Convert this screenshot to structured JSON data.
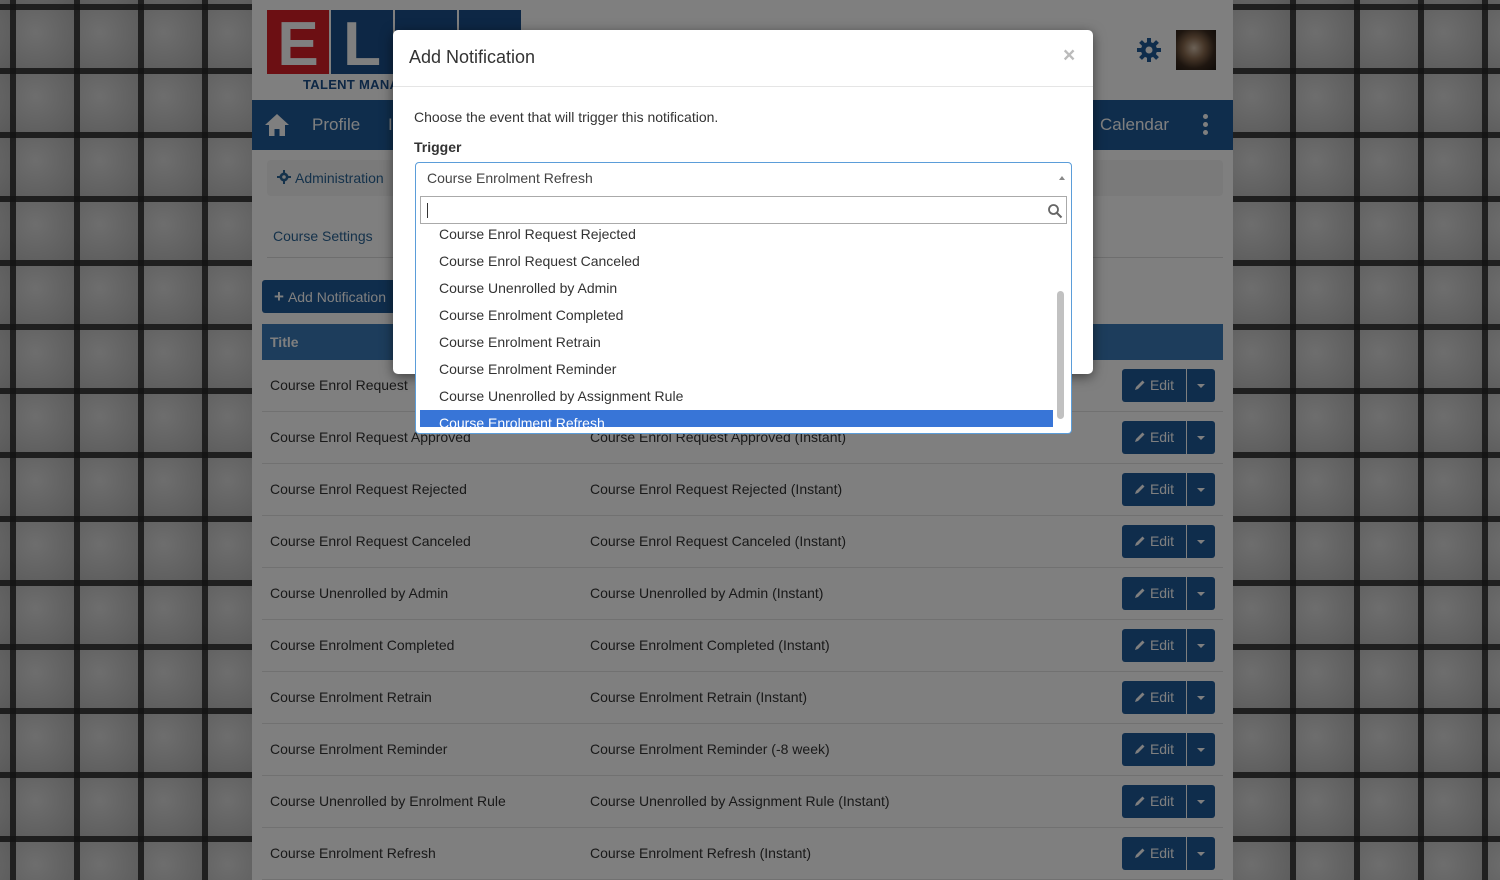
{
  "brand": {
    "logo_letters": "ELMO",
    "logo_subtitle": "TALENT MANA",
    "colors": {
      "red": "#d81f26",
      "blue": "#1a4f8b"
    }
  },
  "header": {
    "settings_icon": "gear-icon",
    "avatar_icon": "user-avatar"
  },
  "nav": {
    "home_icon": "home-icon",
    "items": [
      {
        "label": "Profile"
      },
      {
        "label": "I"
      },
      {
        "label": "Calendar"
      }
    ],
    "more_icon": "kebab-menu-icon",
    "color": "#1f5b99"
  },
  "breadcrumb": {
    "admin_label": "Administration"
  },
  "subnav": {
    "course_settings": "Course Settings"
  },
  "toolbar": {
    "add_notification_label": "Add Notification"
  },
  "table": {
    "header_title": "Title",
    "edit_label": "Edit",
    "rows": [
      {
        "title": "Course Enrol Request",
        "desc": ""
      },
      {
        "title": "Course Enrol Request Approved",
        "desc": "Course Enrol Request Approved (Instant)"
      },
      {
        "title": "Course Enrol Request Rejected",
        "desc": "Course Enrol Request Rejected (Instant)"
      },
      {
        "title": "Course Enrol Request Canceled",
        "desc": "Course Enrol Request Canceled (Instant)"
      },
      {
        "title": "Course Unenrolled by Admin",
        "desc": "Course Unenrolled by Admin (Instant)"
      },
      {
        "title": "Course Enrolment Completed",
        "desc": "Course Enrolment Completed (Instant)"
      },
      {
        "title": "Course Enrolment Retrain",
        "desc": "Course Enrolment Retrain (Instant)"
      },
      {
        "title": "Course Enrolment Reminder",
        "desc": "Course Enrolment Reminder (-8 week)"
      },
      {
        "title": "Course Unenrolled by Enrolment Rule",
        "desc": "Course Unenrolled by Assignment Rule (Instant)"
      },
      {
        "title": "Course Enrolment Refresh",
        "desc": "Course Enrolment Refresh (Instant)"
      }
    ]
  },
  "modal": {
    "title": "Add Notification",
    "close": "×",
    "intro": "Choose the event that will trigger this notification.",
    "trigger_label": "Trigger",
    "selected_value": "Course Enrolment Refresh",
    "search_value": "",
    "options": [
      {
        "label": "Course Enrol Request Rejected",
        "highlighted": false
      },
      {
        "label": "Course Enrol Request Canceled",
        "highlighted": false
      },
      {
        "label": "Course Unenrolled by Admin",
        "highlighted": false
      },
      {
        "label": "Course Enrolment Completed",
        "highlighted": false
      },
      {
        "label": "Course Enrolment Retrain",
        "highlighted": false
      },
      {
        "label": "Course Enrolment Reminder",
        "highlighted": false
      },
      {
        "label": "Course Unenrolled by Assignment Rule",
        "highlighted": false
      },
      {
        "label": "Course Enrolment Refresh",
        "highlighted": true
      }
    ],
    "highlight_color": "#3875d7"
  }
}
